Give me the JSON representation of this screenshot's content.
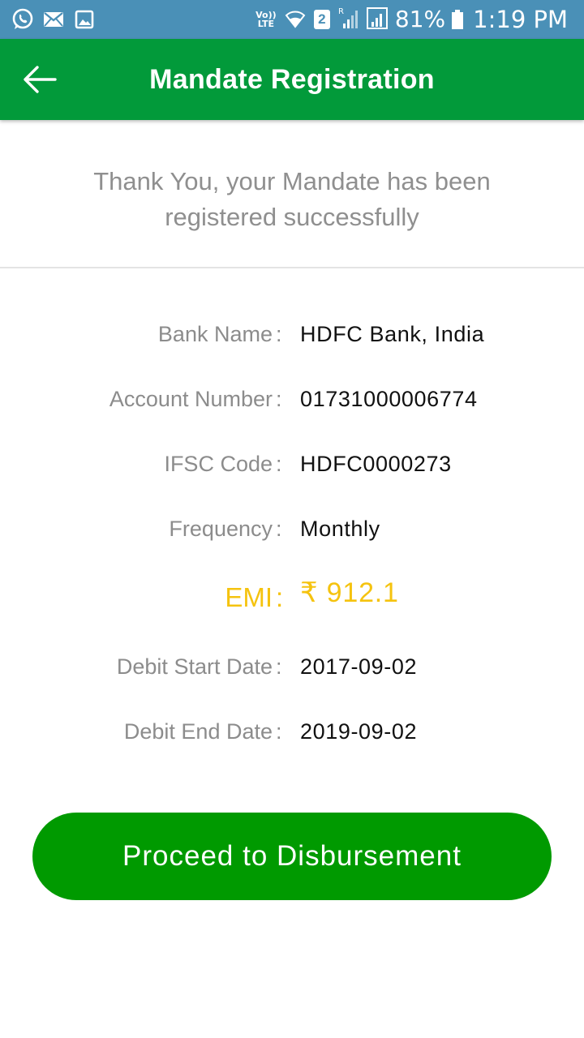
{
  "status_bar": {
    "icons_left": [
      "whatsapp-icon",
      "email-icon",
      "gallery-icon"
    ],
    "network_label_top": "Vo))",
    "network_label_bottom": "LTE",
    "sim_slot": "2",
    "roaming_label": "R",
    "battery_percent": "81%",
    "time": "1:19 PM",
    "bar_color": "#4a90b7"
  },
  "app_bar": {
    "title": "Mandate Registration",
    "back_icon": "arrow-left-icon",
    "color": "#029a3a"
  },
  "message": {
    "line1": "Thank You, your Mandate has been",
    "line2": "registered successfully"
  },
  "details": {
    "bank_name": {
      "label": "Bank Name",
      "value": "HDFC Bank, India"
    },
    "account_number": {
      "label": "Account Number",
      "value": "01731000006774"
    },
    "ifsc_code": {
      "label": "IFSC Code",
      "value": "HDFC0000273"
    },
    "frequency": {
      "label": "Frequency",
      "value": "Monthly"
    },
    "emi": {
      "label": "EMI",
      "value": "₹ 912.1",
      "color": "#f5c30f"
    },
    "debit_start_date": {
      "label": "Debit Start Date",
      "value": "2017-09-02"
    },
    "debit_end_date": {
      "label": "Debit End Date",
      "value": "2019-09-02"
    },
    "separator": ":"
  },
  "actions": {
    "proceed_label": "Proceed to Disbursement",
    "proceed_color": "#009a00"
  }
}
